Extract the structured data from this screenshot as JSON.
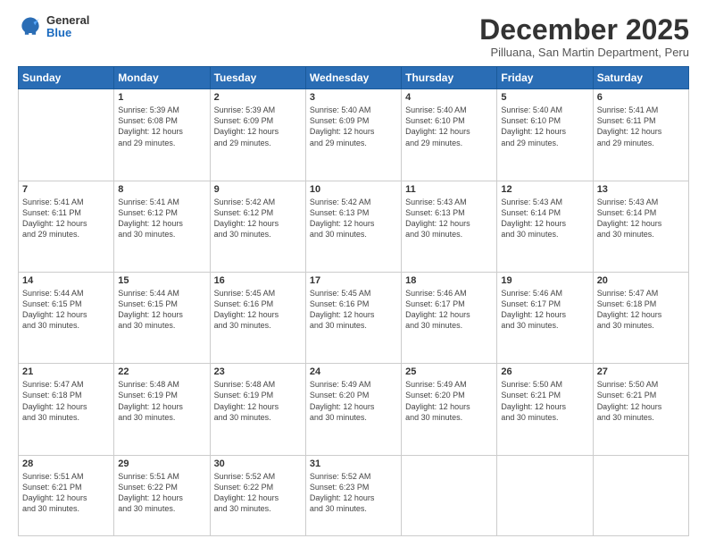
{
  "logo": {
    "general": "General",
    "blue": "Blue"
  },
  "header": {
    "month": "December 2025",
    "location": "Pilluana, San Martin Department, Peru"
  },
  "weekdays": [
    "Sunday",
    "Monday",
    "Tuesday",
    "Wednesday",
    "Thursday",
    "Friday",
    "Saturday"
  ],
  "weeks": [
    [
      {
        "day": "",
        "info": ""
      },
      {
        "day": "1",
        "info": "Sunrise: 5:39 AM\nSunset: 6:08 PM\nDaylight: 12 hours\nand 29 minutes."
      },
      {
        "day": "2",
        "info": "Sunrise: 5:39 AM\nSunset: 6:09 PM\nDaylight: 12 hours\nand 29 minutes."
      },
      {
        "day": "3",
        "info": "Sunrise: 5:40 AM\nSunset: 6:09 PM\nDaylight: 12 hours\nand 29 minutes."
      },
      {
        "day": "4",
        "info": "Sunrise: 5:40 AM\nSunset: 6:10 PM\nDaylight: 12 hours\nand 29 minutes."
      },
      {
        "day": "5",
        "info": "Sunrise: 5:40 AM\nSunset: 6:10 PM\nDaylight: 12 hours\nand 29 minutes."
      },
      {
        "day": "6",
        "info": "Sunrise: 5:41 AM\nSunset: 6:11 PM\nDaylight: 12 hours\nand 29 minutes."
      }
    ],
    [
      {
        "day": "7",
        "info": "Sunrise: 5:41 AM\nSunset: 6:11 PM\nDaylight: 12 hours\nand 29 minutes."
      },
      {
        "day": "8",
        "info": "Sunrise: 5:41 AM\nSunset: 6:12 PM\nDaylight: 12 hours\nand 30 minutes."
      },
      {
        "day": "9",
        "info": "Sunrise: 5:42 AM\nSunset: 6:12 PM\nDaylight: 12 hours\nand 30 minutes."
      },
      {
        "day": "10",
        "info": "Sunrise: 5:42 AM\nSunset: 6:13 PM\nDaylight: 12 hours\nand 30 minutes."
      },
      {
        "day": "11",
        "info": "Sunrise: 5:43 AM\nSunset: 6:13 PM\nDaylight: 12 hours\nand 30 minutes."
      },
      {
        "day": "12",
        "info": "Sunrise: 5:43 AM\nSunset: 6:14 PM\nDaylight: 12 hours\nand 30 minutes."
      },
      {
        "day": "13",
        "info": "Sunrise: 5:43 AM\nSunset: 6:14 PM\nDaylight: 12 hours\nand 30 minutes."
      }
    ],
    [
      {
        "day": "14",
        "info": "Sunrise: 5:44 AM\nSunset: 6:15 PM\nDaylight: 12 hours\nand 30 minutes."
      },
      {
        "day": "15",
        "info": "Sunrise: 5:44 AM\nSunset: 6:15 PM\nDaylight: 12 hours\nand 30 minutes."
      },
      {
        "day": "16",
        "info": "Sunrise: 5:45 AM\nSunset: 6:16 PM\nDaylight: 12 hours\nand 30 minutes."
      },
      {
        "day": "17",
        "info": "Sunrise: 5:45 AM\nSunset: 6:16 PM\nDaylight: 12 hours\nand 30 minutes."
      },
      {
        "day": "18",
        "info": "Sunrise: 5:46 AM\nSunset: 6:17 PM\nDaylight: 12 hours\nand 30 minutes."
      },
      {
        "day": "19",
        "info": "Sunrise: 5:46 AM\nSunset: 6:17 PM\nDaylight: 12 hours\nand 30 minutes."
      },
      {
        "day": "20",
        "info": "Sunrise: 5:47 AM\nSunset: 6:18 PM\nDaylight: 12 hours\nand 30 minutes."
      }
    ],
    [
      {
        "day": "21",
        "info": "Sunrise: 5:47 AM\nSunset: 6:18 PM\nDaylight: 12 hours\nand 30 minutes."
      },
      {
        "day": "22",
        "info": "Sunrise: 5:48 AM\nSunset: 6:19 PM\nDaylight: 12 hours\nand 30 minutes."
      },
      {
        "day": "23",
        "info": "Sunrise: 5:48 AM\nSunset: 6:19 PM\nDaylight: 12 hours\nand 30 minutes."
      },
      {
        "day": "24",
        "info": "Sunrise: 5:49 AM\nSunset: 6:20 PM\nDaylight: 12 hours\nand 30 minutes."
      },
      {
        "day": "25",
        "info": "Sunrise: 5:49 AM\nSunset: 6:20 PM\nDaylight: 12 hours\nand 30 minutes."
      },
      {
        "day": "26",
        "info": "Sunrise: 5:50 AM\nSunset: 6:21 PM\nDaylight: 12 hours\nand 30 minutes."
      },
      {
        "day": "27",
        "info": "Sunrise: 5:50 AM\nSunset: 6:21 PM\nDaylight: 12 hours\nand 30 minutes."
      }
    ],
    [
      {
        "day": "28",
        "info": "Sunrise: 5:51 AM\nSunset: 6:21 PM\nDaylight: 12 hours\nand 30 minutes."
      },
      {
        "day": "29",
        "info": "Sunrise: 5:51 AM\nSunset: 6:22 PM\nDaylight: 12 hours\nand 30 minutes."
      },
      {
        "day": "30",
        "info": "Sunrise: 5:52 AM\nSunset: 6:22 PM\nDaylight: 12 hours\nand 30 minutes."
      },
      {
        "day": "31",
        "info": "Sunrise: 5:52 AM\nSunset: 6:23 PM\nDaylight: 12 hours\nand 30 minutes."
      },
      {
        "day": "",
        "info": ""
      },
      {
        "day": "",
        "info": ""
      },
      {
        "day": "",
        "info": ""
      }
    ]
  ]
}
